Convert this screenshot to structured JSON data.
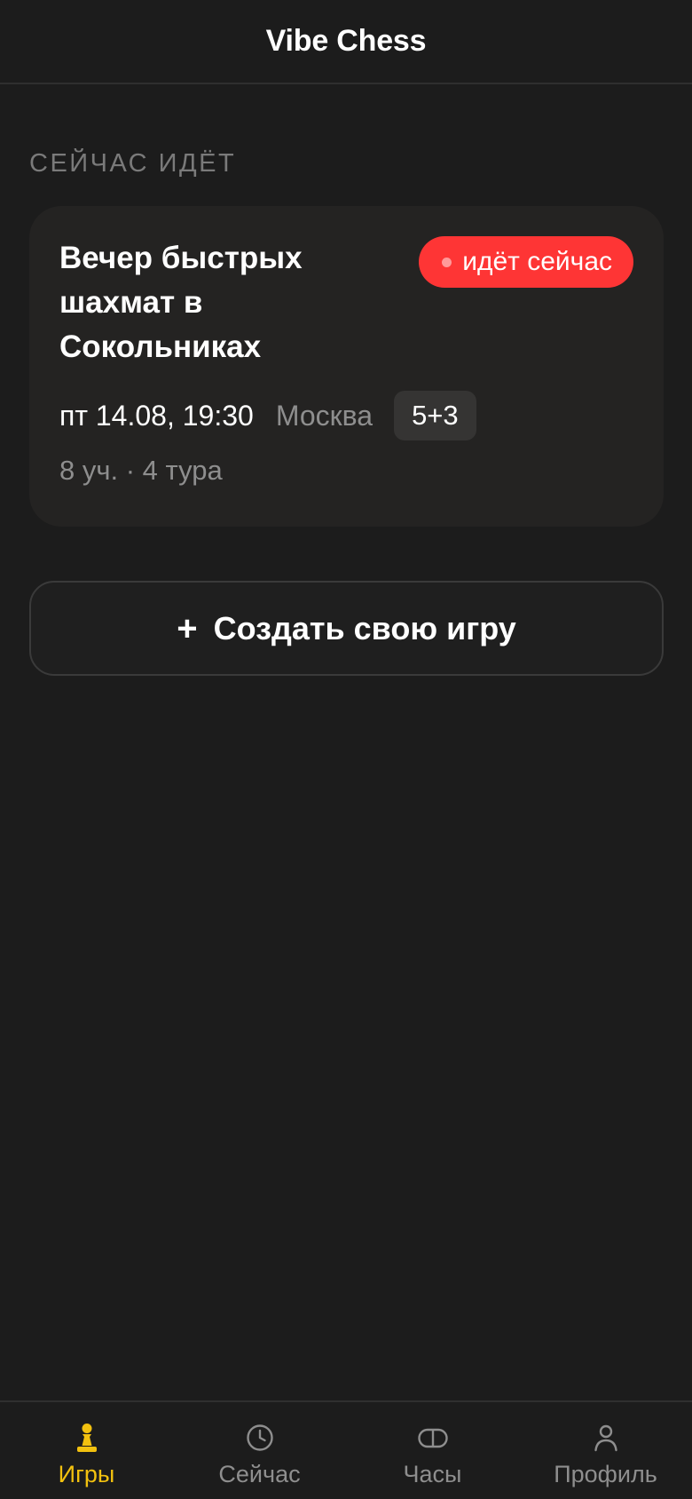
{
  "header": {
    "title": "Vibe Chess"
  },
  "section": {
    "title": "СЕЙЧАС ИДЁТ"
  },
  "event": {
    "title": "Вечер быстрых шахмат в Сокольниках",
    "status": "идёт сейчас",
    "datetime": "пт 14.08, 19:30",
    "city": "Москва",
    "time_control": "5+3",
    "stats": "8 уч. · 4 тура"
  },
  "create_button": {
    "icon": "+",
    "label": "Создать свою игру"
  },
  "tabs": [
    {
      "label": "Игры",
      "icon": "pawn-icon",
      "active": true
    },
    {
      "label": "Сейчас",
      "icon": "clock-icon",
      "active": false
    },
    {
      "label": "Часы",
      "icon": "chess-clock-icon",
      "active": false
    },
    {
      "label": "Профиль",
      "icon": "person-icon",
      "active": false
    }
  ],
  "colors": {
    "background": "#1c1c1c",
    "card": "#242322",
    "live": "#fe3535",
    "accent": "#f2c10f",
    "muted": "#8e8e8e"
  }
}
